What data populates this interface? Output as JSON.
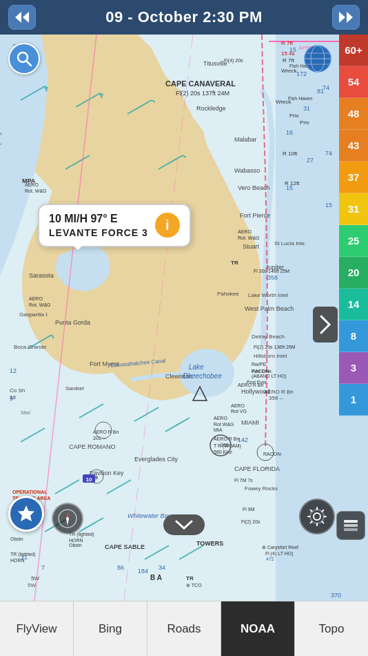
{
  "header": {
    "title": "09 - October  2:30 PM",
    "back_label": "back",
    "forward_label": "forward"
  },
  "wind_callout": {
    "speed": "10 MI/H 97° E",
    "description": "LEVANTE  FORCE 3",
    "info_icon": "ℹ"
  },
  "speed_legend": [
    {
      "value": "60+",
      "color": "#c0392b"
    },
    {
      "value": "54",
      "color": "#e74c3c"
    },
    {
      "value": "48",
      "color": "#e67e22"
    },
    {
      "value": "43",
      "color": "#e67e22"
    },
    {
      "value": "37",
      "color": "#f39c12"
    },
    {
      "value": "31",
      "color": "#f1c40f"
    },
    {
      "value": "25",
      "color": "#2ecc71"
    },
    {
      "value": "20",
      "color": "#27ae60"
    },
    {
      "value": "14",
      "color": "#1abc9c"
    },
    {
      "value": "8",
      "color": "#3498db"
    },
    {
      "value": "3",
      "color": "#9b59b6"
    },
    {
      "value": "1",
      "color": "#3498db"
    }
  ],
  "tabs": [
    {
      "label": "FlyView",
      "active": false
    },
    {
      "label": "Bing",
      "active": false
    },
    {
      "label": "Roads",
      "active": false
    },
    {
      "label": "NOAA",
      "active": true
    },
    {
      "label": "Topo",
      "active": false
    }
  ],
  "buttons": {
    "search": "search",
    "globe": "globe",
    "star": "star",
    "compass": "compass",
    "gear": "settings",
    "layers": "layers",
    "nav_arrow": "chevron-right",
    "down_arrow": "chevron-down"
  }
}
